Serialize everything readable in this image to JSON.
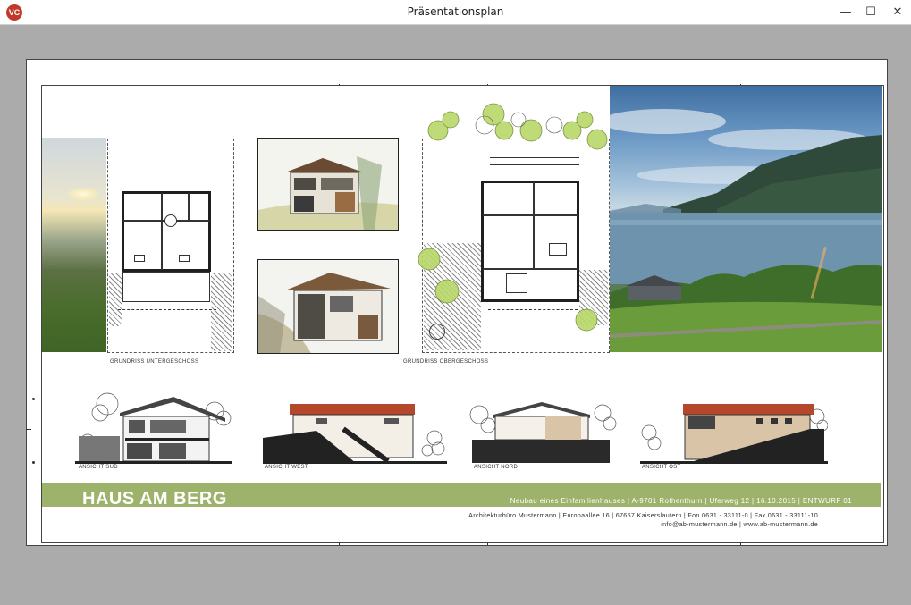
{
  "window": {
    "title": "Präsentationsplan",
    "app_icon": "vc-logo-icon",
    "minimize": "—",
    "maximize": "☐",
    "close": "✕"
  },
  "sheet": {
    "plan_labels": {
      "lower_floor": "GRUNDRISS UNTERGESCHOSS",
      "upper_floor": "GRUNDRISS OBERGESCHOSS"
    },
    "elevation_labels": {
      "south": "ANSICHT SÜD",
      "west": "ANSICHT WEST",
      "north": "ANSICHT NORD",
      "east": "ANSICHT OST"
    },
    "title_block": {
      "project_title": "HAUS AM BERG",
      "project_info": "Neubau eines Einfamilienhauses  |  A-9701 Rothenthurn  |  Uferweg 12  |  16.10.2015  |  ENTWURF 01",
      "office_line": "Architekturbüro Mustermann  |  Europaallee 16  |  67657 Kaiserslautern  |  Fon 0631 - 33111-0  |  Fax 0631 - 33111-10",
      "contact_line": "info@ab-mustermann.de  |  www.ab-mustermann.de"
    },
    "colors": {
      "band": "#9db26a",
      "roof_red": "#b5472b",
      "tree_green": "#b9d86a"
    }
  }
}
